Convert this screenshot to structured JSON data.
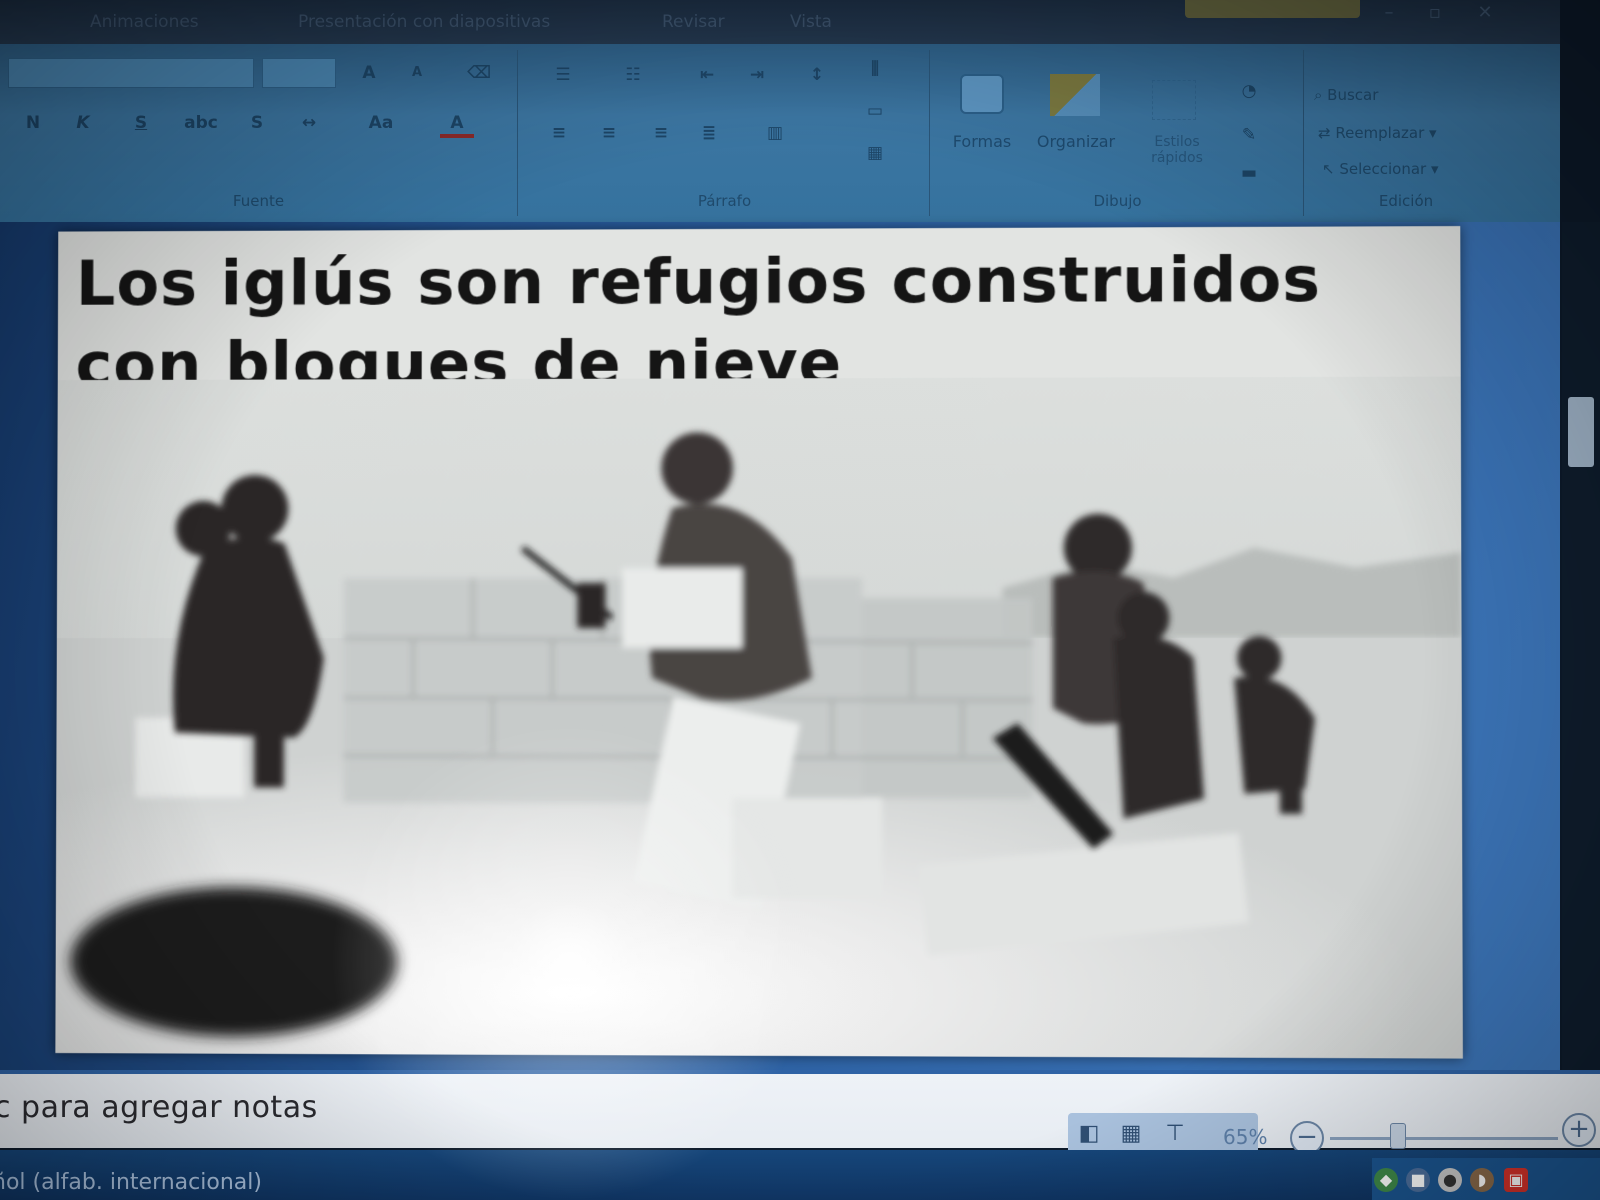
{
  "tabs": {
    "items": [
      {
        "label": "Animaciones"
      },
      {
        "label": "Presentación con diapositivas"
      },
      {
        "label": "Revisar"
      },
      {
        "label": "Vista"
      }
    ]
  },
  "ribbon": {
    "groups": {
      "font": {
        "label": "Fuente",
        "buttons": {
          "bold": "N",
          "italic": "K",
          "underline": "S",
          "change_case": "Aa",
          "font_color": "A",
          "grow": "A",
          "shrink": "A"
        }
      },
      "paragraph": {
        "label": "Párrafo"
      },
      "drawing": {
        "label": "Dibujo",
        "shapes_label": "Formas",
        "arrange_label": "Organizar",
        "quick_styles_label": "Estilos rápidos"
      },
      "editing": {
        "label": "Edición",
        "find_label": "Buscar",
        "replace_label": "Reemplazar",
        "select_label": "Seleccionar"
      }
    }
  },
  "slide": {
    "title_line1": "Los iglús son refugios construidos",
    "title_line2": "con bloques de nieve",
    "photo_subject": "inuit-building-igloo-photo"
  },
  "notes": {
    "placeholder_fragment": "para agregar notas"
  },
  "status": {
    "zoom": "65%",
    "zoom_level": 0.3,
    "language_fragment": "ñol (alfab. internacional)"
  },
  "colors": {
    "ribbon_blue": "#3c76a2",
    "workspace_blue": "#2a5ea0",
    "slide_bg": "#e2e4e2",
    "taskbar": "#16467a",
    "tray_red": "#d6322a"
  }
}
